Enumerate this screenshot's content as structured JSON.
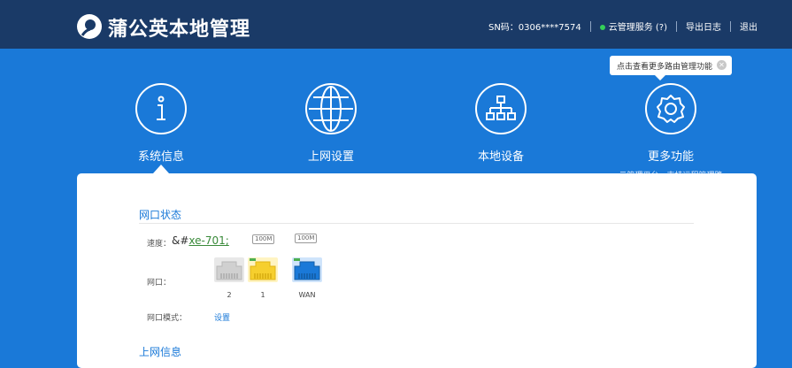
{
  "header": {
    "brand": "蒲公英本地管理",
    "sn": "SN码：0306****7574",
    "cloud_service": "云管理服务 (?)",
    "export_log": "导出日志",
    "logout": "退出",
    "status_color": "#34d058"
  },
  "nav": {
    "items": [
      {
        "label": "系统信息",
        "icon": "info-icon"
      },
      {
        "label": "上网设置",
        "icon": "globe-icon"
      },
      {
        "label": "本地设备",
        "icon": "network-tree-icon"
      },
      {
        "label": "更多功能",
        "icon": "gear-icon",
        "sub": "云管理平台，支持远程管理路由器"
      }
    ]
  },
  "tooltip": {
    "text": "点击查看更多路由管理功能",
    "close": "✕"
  },
  "panel": {
    "port_status_title": "网口状态",
    "speed_label": "速度：",
    "speed_value_prefix": "&#",
    "speed_value_link": "xe-701;",
    "speed_badges": [
      "100M",
      "100M"
    ],
    "port_label": "网口：",
    "ports": [
      {
        "name": "2",
        "color": "#d0d0d0",
        "state": "off"
      },
      {
        "name": "1",
        "color": "#f6cf2e",
        "state": "on"
      },
      {
        "name": "WAN",
        "color": "#1a79d8",
        "state": "on"
      }
    ],
    "port_mode_label": "网口模式：",
    "port_mode_link": "设置",
    "next_section_title": "上网信息"
  }
}
